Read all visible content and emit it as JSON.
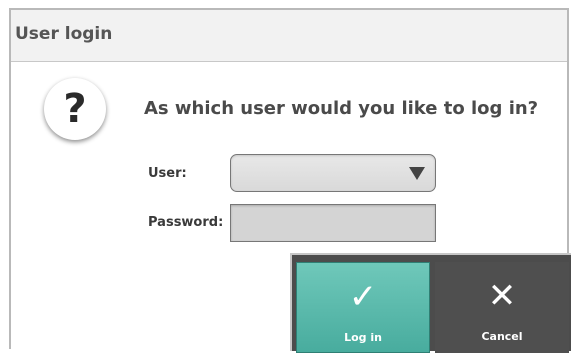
{
  "dialog": {
    "title": "User login",
    "question": "As which user would you like to log in?",
    "question_icon": "question-mark-icon"
  },
  "form": {
    "user_label": "User:",
    "user_value": "",
    "password_label": "Password:",
    "password_value": ""
  },
  "buttons": {
    "login_label": "Log in",
    "login_icon": "checkmark-icon",
    "cancel_label": "Cancel",
    "cancel_icon": "close-icon"
  },
  "colors": {
    "login_accent": "#5dbcae",
    "cancel_bg": "#4f4f4f",
    "title_bg": "#f2f2f2"
  }
}
